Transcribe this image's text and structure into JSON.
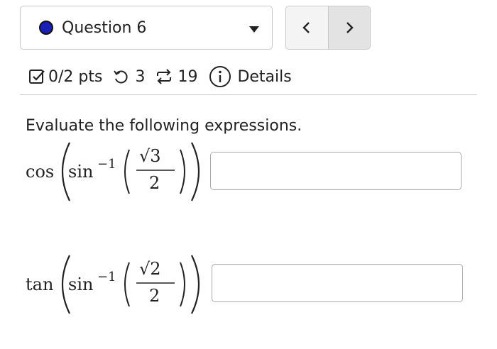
{
  "question_select": {
    "label": "Question 6",
    "status_color": "#1a1fb8"
  },
  "nav": {
    "prev_icon": "chevron-left-icon",
    "next_icon": "chevron-right-icon"
  },
  "info": {
    "points": "0/2 pts",
    "retries": "3",
    "attempts": "19",
    "details": "Details"
  },
  "problem": {
    "prompt": "Evaluate the following expressions.",
    "expressions": [
      {
        "outer_fn": "cos",
        "inner_fn": "sin",
        "exponent": "−1",
        "numerator": "√3",
        "denominator": "2",
        "answer_value": ""
      },
      {
        "outer_fn": "tan",
        "inner_fn": "sin",
        "exponent": "−1",
        "numerator": "√2",
        "denominator": "2",
        "answer_value": ""
      }
    ]
  }
}
